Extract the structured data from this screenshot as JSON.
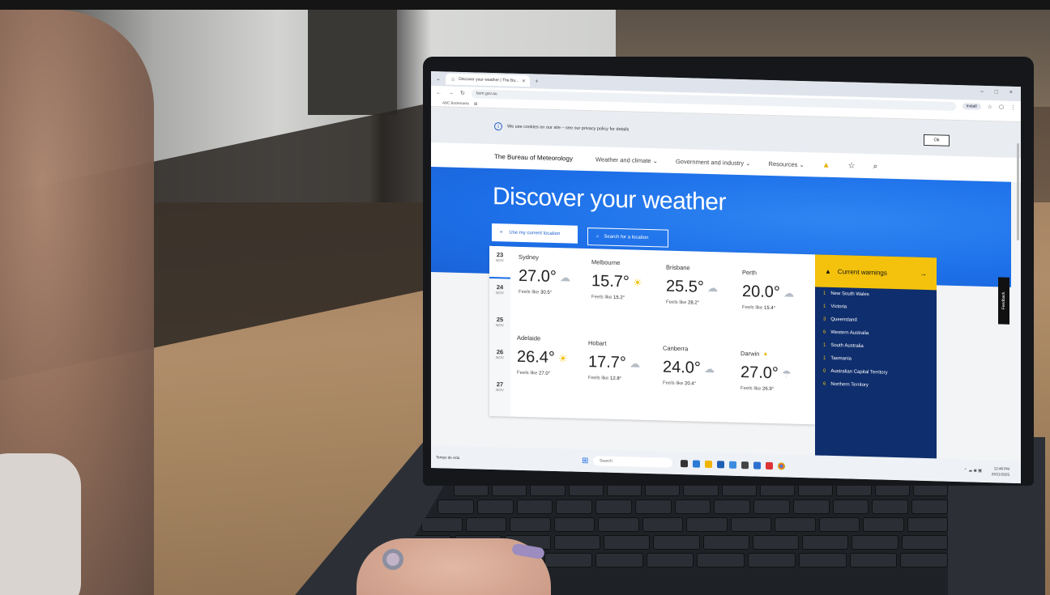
{
  "browser": {
    "tab_title": "Discover your weather | The Bu...",
    "address": "bom.gov.au",
    "install_label": "Install",
    "bookmarks_label": "ABC Bookmarks"
  },
  "cookie": {
    "text": "We use cookies on our site – see our privacy policy for details",
    "ok_label": "Ok"
  },
  "nav": {
    "brand": "The Bureau of Meteorology",
    "items": [
      "Weather and climate ⌄",
      "Government and industry ⌄",
      "Resources ⌄"
    ]
  },
  "hero": {
    "title": "Discover your weather",
    "location_btn": "Use my current location",
    "search_btn": "Search for a location"
  },
  "dates": [
    {
      "day": "23",
      "month": "NOV"
    },
    {
      "day": "24",
      "month": "NOV"
    },
    {
      "day": "25",
      "month": "NOV"
    },
    {
      "day": "26",
      "month": "NOV"
    },
    {
      "day": "27",
      "month": "NOV"
    }
  ],
  "cities": [
    {
      "name": "Sydney",
      "temp": "27.0°",
      "feels_label": "Feels like",
      "feels": "30.5°",
      "icon": "partly-cloudy-icon"
    },
    {
      "name": "Melbourne",
      "temp": "15.7°",
      "feels_label": "Feels like",
      "feels": "15.2°",
      "icon": "sun-icon"
    },
    {
      "name": "Brisbane",
      "temp": "25.5°",
      "feels_label": "Feels like",
      "feels": "28.2°",
      "icon": "partly-cloudy-icon"
    },
    {
      "name": "Perth",
      "temp": "20.0°",
      "feels_label": "Feels like",
      "feels": "15.4°",
      "icon": "partly-cloudy-icon"
    },
    {
      "name": "Adelaide",
      "temp": "26.4°",
      "feels_label": "Feels like",
      "feels": "27.0°",
      "icon": "sun-icon"
    },
    {
      "name": "Hobart",
      "temp": "17.7°",
      "feels_label": "Feels like",
      "feels": "12.8°",
      "icon": "partly-cloudy-icon"
    },
    {
      "name": "Canberra",
      "temp": "24.0°",
      "feels_label": "Feels like",
      "feels": "20.4°",
      "icon": "partly-cloudy-icon"
    },
    {
      "name": "Darwin",
      "temp": "27.0°",
      "feels_label": "Feels like",
      "feels": "26.9°",
      "icon": "storm-icon"
    }
  ],
  "warnings": {
    "title": "Current warnings",
    "rows": [
      {
        "count": "1",
        "state": "New South Wales"
      },
      {
        "count": "1",
        "state": "Victoria"
      },
      {
        "count": "3",
        "state": "Queensland"
      },
      {
        "count": "6",
        "state": "Western Australia"
      },
      {
        "count": "1",
        "state": "South Australia"
      },
      {
        "count": "1",
        "state": "Tasmania"
      },
      {
        "count": "0",
        "state": "Australian Capital Territory"
      },
      {
        "count": "6",
        "state": "Northern Territory"
      }
    ]
  },
  "feedback_label": "Feedback",
  "taskbar": {
    "weather": "Tempo de vida",
    "search": "Search",
    "time": "12:46 PM",
    "date": "23/11/2025"
  },
  "colors": {
    "hero_blue": "#1d6fe8",
    "warning_yellow": "#f4c20d",
    "warning_navy": "#0f2e6d"
  }
}
